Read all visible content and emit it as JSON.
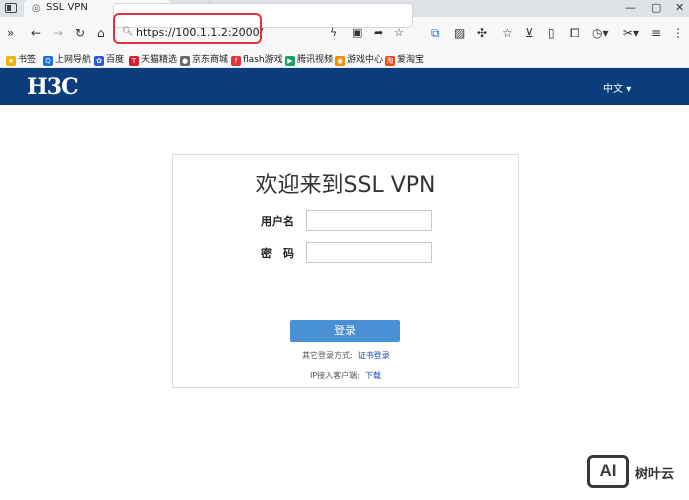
{
  "browser": {
    "tab_title": "SSL VPN",
    "tab_close": "×",
    "new_tab": "+",
    "url": "https://100.1.1.2:2000/",
    "window_controls": [
      "—",
      "▢",
      "✕"
    ],
    "bookmarks": [
      {
        "label": "书签",
        "icon": "star-icon",
        "color": "#f0b400"
      },
      {
        "label": "上网导航",
        "icon": "q-icon",
        "color": "#1a6fd8"
      },
      {
        "label": "百度",
        "icon": "paw-icon",
        "color": "#2f58d8"
      },
      {
        "label": "天猫精选",
        "icon": "tmall-icon",
        "color": "#d8202a"
      },
      {
        "label": "京东商城",
        "icon": "jd-icon",
        "color": "#666666"
      },
      {
        "label": "flash游戏",
        "icon": "flash-icon",
        "color": "#e0343a"
      },
      {
        "label": "腾讯视频",
        "icon": "video-icon",
        "color": "#1aa260"
      },
      {
        "label": "游戏中心",
        "icon": "gamepad-icon",
        "color": "#f08c00"
      },
      {
        "label": "爱淘宝",
        "icon": "taobao-icon",
        "color": "#e84a1a"
      }
    ]
  },
  "header": {
    "logo": "H3C",
    "language": "中文",
    "background": "#0c3d7d"
  },
  "login": {
    "welcome": "欢迎来到SSL VPN",
    "username_label": "用户名",
    "password_label": "密　码",
    "username_value": "",
    "password_value": "",
    "submit_label": "登录",
    "other_methods_label": "其它登录方式:",
    "cert_login_link": "证书登录",
    "client_label": "IP接入客户端:",
    "download_link": "下载",
    "button_color": "#4a90d4"
  },
  "watermark": {
    "logo": "AI",
    "text": "树叶云"
  }
}
